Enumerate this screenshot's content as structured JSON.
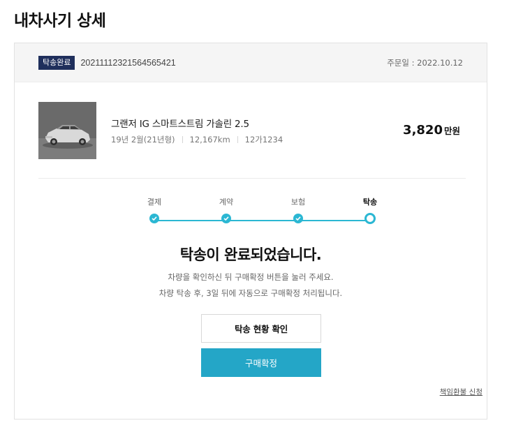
{
  "page": {
    "title": "내차사기 상세"
  },
  "order": {
    "status_badge": "탁송완료",
    "order_number": "20211112321564565421",
    "order_date": "주문일 : 2022.10.12"
  },
  "product": {
    "name": "그랜저 IG 스마트스트림 가솔린 2.5",
    "year": "19년 2월(21년형)",
    "mileage": "12,167km",
    "plate": "12가1234",
    "price_value": "3,820",
    "price_unit": "만원"
  },
  "steps": [
    {
      "label": "결제",
      "state": "done"
    },
    {
      "label": "계약",
      "state": "done"
    },
    {
      "label": "보험",
      "state": "done"
    },
    {
      "label": "탁송",
      "state": "current"
    }
  ],
  "status": {
    "headline": "탁송이 완료되었습니다.",
    "line1": "차량을 확인하신 뒤 구매확정 버튼을 눌러 주세요.",
    "line2": "차량 탁송 후, 3일 뒤에 자동으로 구매확정 처리됩니다."
  },
  "actions": {
    "track_delivery": "탁송 현황 확인",
    "confirm_purchase": "구매확정",
    "refund_link": "책임환불 신청"
  },
  "colors": {
    "accent": "#24a6c7",
    "badge": "#1f2f5c",
    "step": "#2bb7d3"
  }
}
